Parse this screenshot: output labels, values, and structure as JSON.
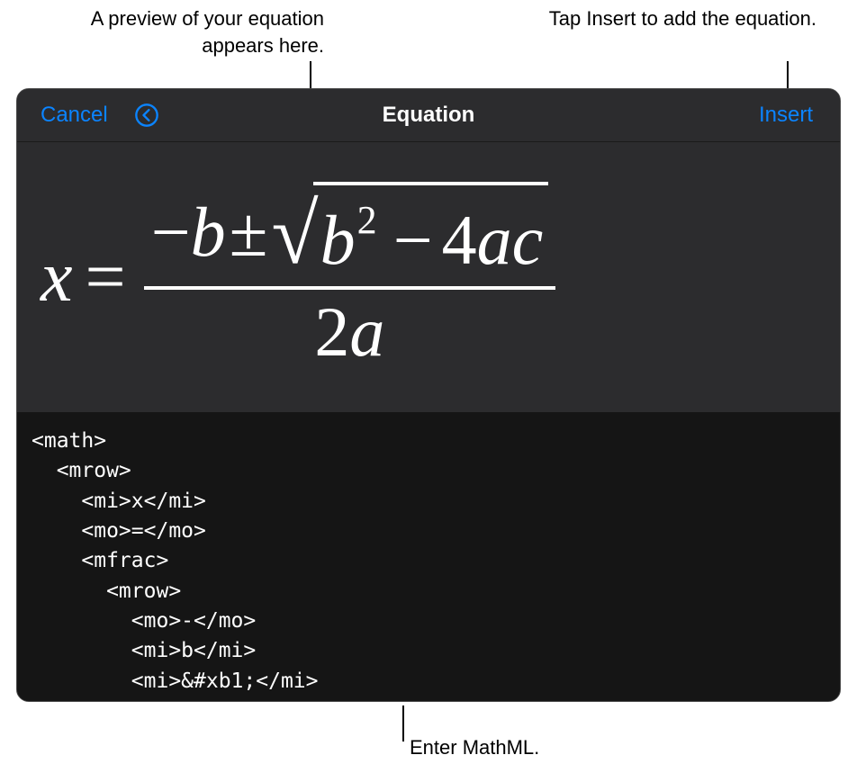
{
  "callouts": {
    "preview": "A preview of your equation appears here.",
    "insert": "Tap Insert to add the equation.",
    "mathml": "Enter MathML."
  },
  "header": {
    "cancel_label": "Cancel",
    "title": "Equation",
    "insert_label": "Insert"
  },
  "equation_preview": {
    "lhs": "x",
    "eq": "=",
    "numerator_minus": "−",
    "numerator_b": "b",
    "pm": "±",
    "sqrt_b": "b",
    "sqrt_exp": "2",
    "sqrt_minus": "−",
    "sqrt_4": "4",
    "sqrt_a": "a",
    "sqrt_c": "c",
    "denom_2": "2",
    "denom_a": "a"
  },
  "code": "<math>\n  <mrow>\n    <mi>x</mi>\n    <mo>=</mo>\n    <mfrac>\n      <mrow>\n        <mo>-</mo>\n        <mi>b</mi>\n        <mi>&#xb1;</mi>"
}
